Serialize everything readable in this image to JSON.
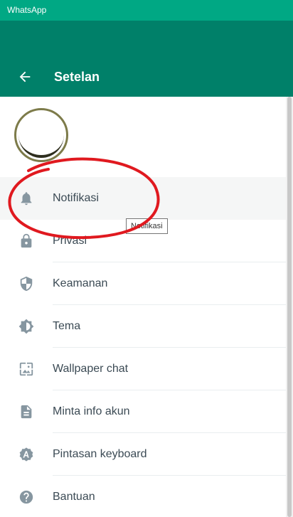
{
  "window": {
    "app_name": "WhatsApp"
  },
  "header": {
    "title": "Setelan",
    "back_icon": "arrow-left-icon"
  },
  "profile": {
    "avatar_icon": "profile-avatar"
  },
  "menu": {
    "items": [
      {
        "label": "Notifikasi",
        "icon": "bell-icon",
        "active": true
      },
      {
        "label": "Privasi",
        "icon": "lock-icon"
      },
      {
        "label": "Keamanan",
        "icon": "shield-icon"
      },
      {
        "label": "Tema",
        "icon": "brightness-icon"
      },
      {
        "label": "Wallpaper chat",
        "icon": "wallpaper-icon"
      },
      {
        "label": "Minta info akun",
        "icon": "document-icon"
      },
      {
        "label": "Pintasan keyboard",
        "icon": "keyboard-shortcut-icon"
      },
      {
        "label": "Bantuan",
        "icon": "help-icon"
      }
    ]
  },
  "tooltip": {
    "text": "Notifikasi"
  },
  "colors": {
    "titlebar": "#00a884",
    "header": "#008069",
    "icon": "#8696a0",
    "annotation": "#e0191f"
  }
}
